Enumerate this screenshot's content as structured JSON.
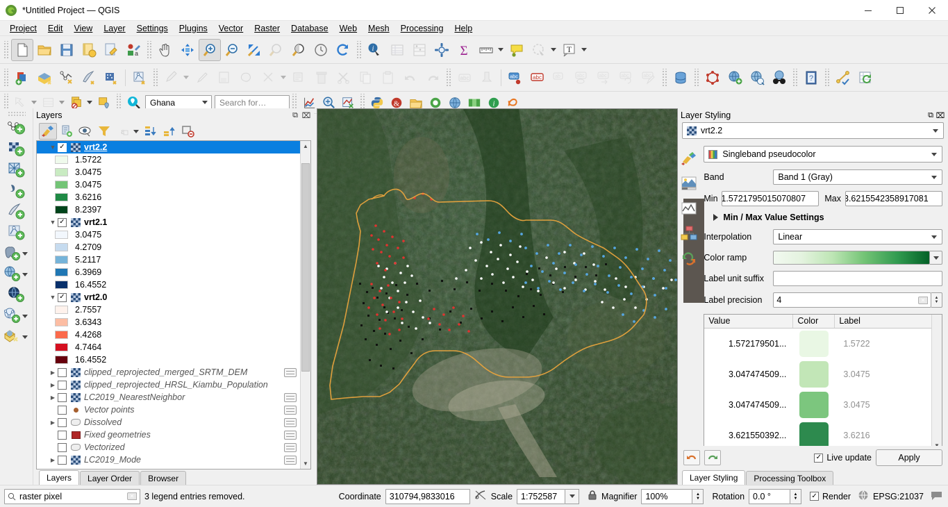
{
  "window": {
    "title": "*Untitled Project — QGIS",
    "logo_icon": "qgis-logo-icon",
    "minimize_label": "—",
    "maximize_label": "❐",
    "close_label": "✕"
  },
  "menubar": {
    "items": [
      {
        "label": "Project"
      },
      {
        "label": "Edit"
      },
      {
        "label": "View"
      },
      {
        "label": "Layer"
      },
      {
        "label": "Settings"
      },
      {
        "label": "Plugins"
      },
      {
        "label": "Vector"
      },
      {
        "label": "Raster"
      },
      {
        "label": "Database"
      },
      {
        "label": "Web"
      },
      {
        "label": "Mesh"
      },
      {
        "label": "Processing"
      },
      {
        "label": "Help"
      }
    ]
  },
  "toolbar_row3": {
    "region_combo_value": "Ghana",
    "search_placeholder": "Search for…"
  },
  "layers_panel": {
    "title": "Layers",
    "dock_float_label": "⧉",
    "dock_close_label": "⌧",
    "toolbar_buttons": [
      {
        "name": "open-layer-styling-panel",
        "icon": "paintbrush-icon",
        "active": true
      },
      {
        "name": "add-group",
        "icon": "add-group-icon",
        "active": false
      },
      {
        "name": "manage-map-themes",
        "icon": "eye-icon",
        "active": false
      },
      {
        "name": "filter-legend",
        "icon": "funnel-icon",
        "active": false
      },
      {
        "name": "filter-legend-expression",
        "icon": "epsilon-icon",
        "active": false,
        "disabled": true
      },
      {
        "name": "expand-all",
        "icon": "expand-all-icon",
        "active": false
      },
      {
        "name": "collapse-all",
        "icon": "collapse-all-icon",
        "active": false
      },
      {
        "name": "remove-layer",
        "icon": "remove-layer-icon",
        "active": false
      }
    ],
    "tree": [
      {
        "type": "layer",
        "name": "vrt2.2",
        "checked": true,
        "expanded": true,
        "selected": true,
        "style": "underline-bold",
        "icon": "raster-icon"
      },
      {
        "type": "legend",
        "label": "1.5722",
        "color": "#effaec"
      },
      {
        "type": "legend",
        "label": "3.0475",
        "color": "#c9ebc2"
      },
      {
        "type": "legend",
        "label": "3.0475",
        "color": "#73c476"
      },
      {
        "type": "legend",
        "label": "3.6216",
        "color": "#1f8a45"
      },
      {
        "type": "legend",
        "label": "8.2397",
        "color": "#00441b"
      },
      {
        "type": "layer",
        "name": "vrt2.1",
        "checked": true,
        "expanded": true,
        "selected": false,
        "style": "bold",
        "icon": "raster-icon"
      },
      {
        "type": "legend",
        "label": "3.0475",
        "color": "#f2f7fd"
      },
      {
        "type": "legend",
        "label": "4.2709",
        "color": "#c6dbef"
      },
      {
        "type": "legend",
        "label": "5.2117",
        "color": "#76b4d9"
      },
      {
        "type": "legend",
        "label": "6.3969",
        "color": "#2077b4"
      },
      {
        "type": "legend",
        "label": "16.4552",
        "color": "#08306b"
      },
      {
        "type": "layer",
        "name": "vrt2.0",
        "checked": true,
        "expanded": true,
        "selected": false,
        "style": "bold",
        "icon": "raster-icon"
      },
      {
        "type": "legend",
        "label": "2.7557",
        "color": "#fff2ec"
      },
      {
        "type": "legend",
        "label": "3.6343",
        "color": "#fcbda3"
      },
      {
        "type": "legend",
        "label": "4.4268",
        "color": "#fb6a4b"
      },
      {
        "type": "legend",
        "label": "4.7464",
        "color": "#d50f20"
      },
      {
        "type": "legend",
        "label": "16.4552",
        "color": "#67000d"
      },
      {
        "type": "layer",
        "name": "clipped_reprojected_merged_SRTM_DEM",
        "checked": false,
        "expanded": false,
        "collapsible": true,
        "style": "italic",
        "icon": "raster-icon",
        "edit_chip": true
      },
      {
        "type": "layer",
        "name": "clipped_reprojected_HRSL_Kiambu_Population",
        "checked": false,
        "expanded": false,
        "collapsible": true,
        "style": "italic",
        "icon": "raster-icon",
        "edit_chip": false
      },
      {
        "type": "layer",
        "name": "LC2019_NearestNeighbor",
        "checked": false,
        "expanded": false,
        "collapsible": true,
        "style": "italic",
        "icon": "raster-icon",
        "edit_chip": true
      },
      {
        "type": "layer",
        "name": "Vector points",
        "checked": false,
        "expanded": false,
        "collapsible": false,
        "style": "italic",
        "icon": "point-icon",
        "edit_chip": true
      },
      {
        "type": "layer",
        "name": "Dissolved",
        "checked": false,
        "expanded": false,
        "collapsible": true,
        "style": "italic",
        "icon": "polygon-icon",
        "edit_chip": true
      },
      {
        "type": "layer",
        "name": "Fixed geometries",
        "checked": false,
        "expanded": false,
        "collapsible": false,
        "style": "italic",
        "icon": "fill-icon",
        "edit_chip": true
      },
      {
        "type": "layer",
        "name": "Vectorized",
        "checked": false,
        "expanded": false,
        "collapsible": false,
        "style": "italic",
        "icon": "polygon-icon",
        "edit_chip": true
      },
      {
        "type": "layer",
        "name": "LC2019_Mode",
        "checked": false,
        "expanded": false,
        "collapsible": true,
        "style": "italic",
        "icon": "raster-icon",
        "edit_chip": true
      }
    ],
    "tabs": [
      {
        "label": "Layers",
        "active": true
      },
      {
        "label": "Layer Order",
        "active": false
      },
      {
        "label": "Browser",
        "active": false
      }
    ]
  },
  "style_panel": {
    "title": "Layer Styling",
    "dock_float_label": "⧉",
    "dock_close_label": "⌧",
    "layer_combo_value": "vrt2.2",
    "rail_buttons": [
      {
        "name": "symbology-tab",
        "icon": "paintbrush-icon"
      },
      {
        "name": "transparency-tab",
        "icon": "transparency-icon"
      },
      {
        "name": "histogram-tab",
        "icon": "histogram-icon"
      },
      {
        "name": "rendering-tab",
        "icon": "rendering-icon"
      },
      {
        "name": "history-tab",
        "icon": "undo-history-icon"
      }
    ],
    "renderer_value": "Singleband pseudocolor",
    "renderer_icon": "color-ramp-icon",
    "band_label": "Band",
    "band_value": "Band 1 (Gray)",
    "min_label": "Min",
    "min_value": "1.5721795015070807",
    "max_label": "Max",
    "max_value": "3.6215542358917081",
    "minmax_settings_label": "Min / Max Value Settings",
    "interpolation_label": "Interpolation",
    "interpolation_value": "Linear",
    "color_ramp_label": "Color ramp",
    "label_unit_suffix_label": "Label unit suffix",
    "label_unit_suffix_value": "",
    "label_precision_label": "Label precision",
    "label_precision_value": "4",
    "table": {
      "headers": [
        "Value",
        "Color",
        "Label"
      ],
      "rows": [
        {
          "value": "1.572179501...",
          "color": "#e9f7e4",
          "label": "1.5722"
        },
        {
          "value": "3.047474509...",
          "color": "#c2e6b7",
          "label": "3.0475"
        },
        {
          "value": "3.047474509...",
          "color": "#7cc67e",
          "label": "3.0475"
        },
        {
          "value": "3.621550392...",
          "color": "#2d8a4e",
          "label": "3.6216"
        }
      ]
    },
    "undo_label": "undo-icon",
    "redo_label": "redo-icon",
    "live_update_label": "Live update",
    "live_update_checked": true,
    "apply_label": "Apply",
    "tabs": [
      {
        "label": "Layer Styling",
        "active": true
      },
      {
        "label": "Processing Toolbox",
        "active": false
      }
    ]
  },
  "statusbar": {
    "search_value": "raster pixel",
    "search_icon": "magnifier-icon",
    "clear_icon": "clear-icon",
    "message": "3 legend entries removed.",
    "coordinate_label": "Coordinate",
    "coordinate_value": "310794,9833016",
    "scale_label": "Scale",
    "scale_value": "1:752587",
    "magnifier_label": "Magnifier",
    "magnifier_value": "100%",
    "lock_icon": "lock-icon",
    "rotation_label": "Rotation",
    "rotation_value": "0.0 °",
    "render_label": "Render",
    "render_checked": true,
    "crs_label": "EPSG:21037",
    "crs_icon": "globe-icon",
    "messages_icon": "message-bubble-icon"
  },
  "map": {
    "basemap_description": "satellite-imagery",
    "boundary_color": "#e8a33d",
    "point_colors": {
      "red": "#e33",
      "blue": "#4ea3e0",
      "white": "#ffffff",
      "black": "#111111"
    }
  },
  "colors": {
    "selection_blue": "#0a7fe0",
    "panel_bg": "#f0f0f0",
    "rail_dark": "#5c5650"
  }
}
